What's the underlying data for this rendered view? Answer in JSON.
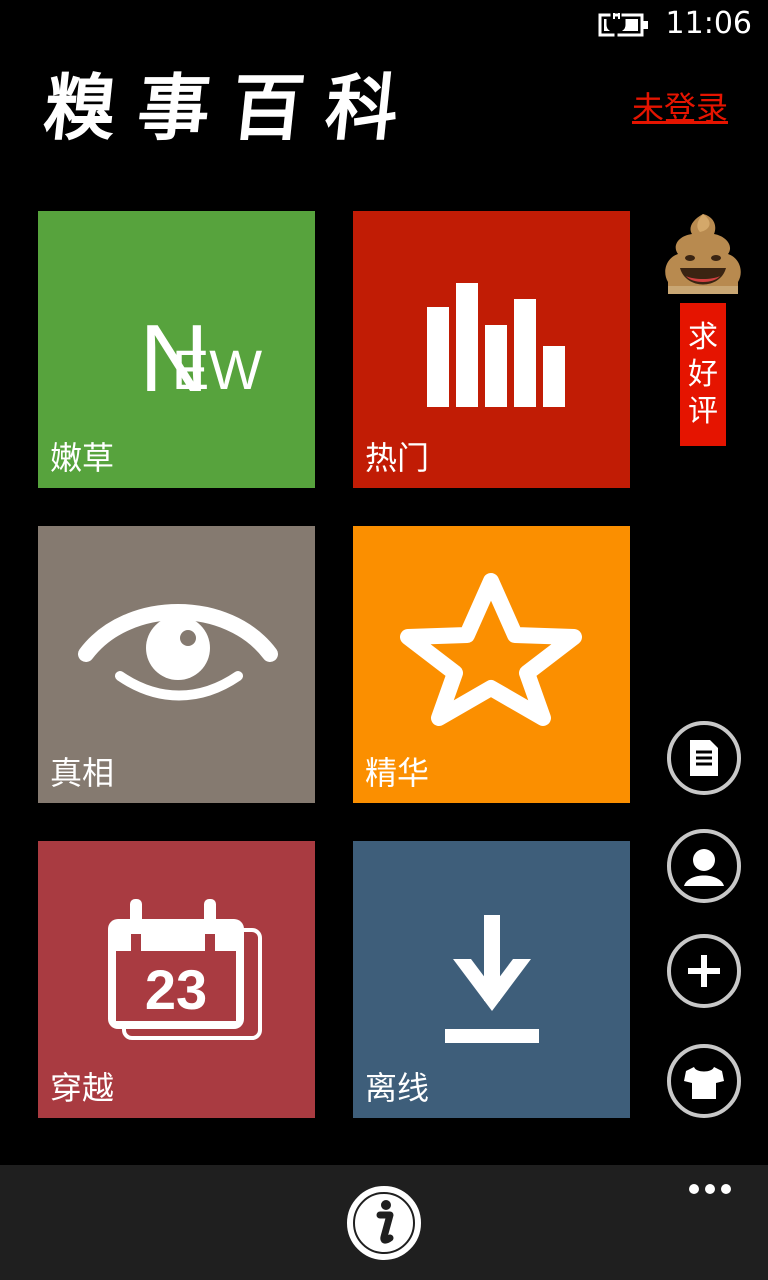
{
  "status": {
    "time": "11:06"
  },
  "header": {
    "title": "糗事百科",
    "login_label": "未登录"
  },
  "tiles": [
    {
      "label": "嫩草",
      "icon": "new-icon",
      "icon_text": "NEW",
      "color": "#57a33d"
    },
    {
      "label": "热门",
      "icon": "bar-chart-icon",
      "color": "#c11c05"
    },
    {
      "label": "真相",
      "icon": "eye-icon",
      "color": "#857a70"
    },
    {
      "label": "精华",
      "icon": "star-icon",
      "color": "#fb8f00"
    },
    {
      "label": "穿越",
      "icon": "calendar-icon",
      "icon_text": "23",
      "color": "#a93b41"
    },
    {
      "label": "离线",
      "icon": "download-icon",
      "color": "#3e5e7a"
    }
  ],
  "sidebar": {
    "rate_label": [
      "求",
      "好",
      "评"
    ],
    "rate_color": "#e51400",
    "buttons": [
      "document-icon",
      "user-icon",
      "add-icon",
      "tshirt-icon"
    ]
  },
  "app_bar": {
    "main_button": "info-icon",
    "more": "more-icon"
  }
}
